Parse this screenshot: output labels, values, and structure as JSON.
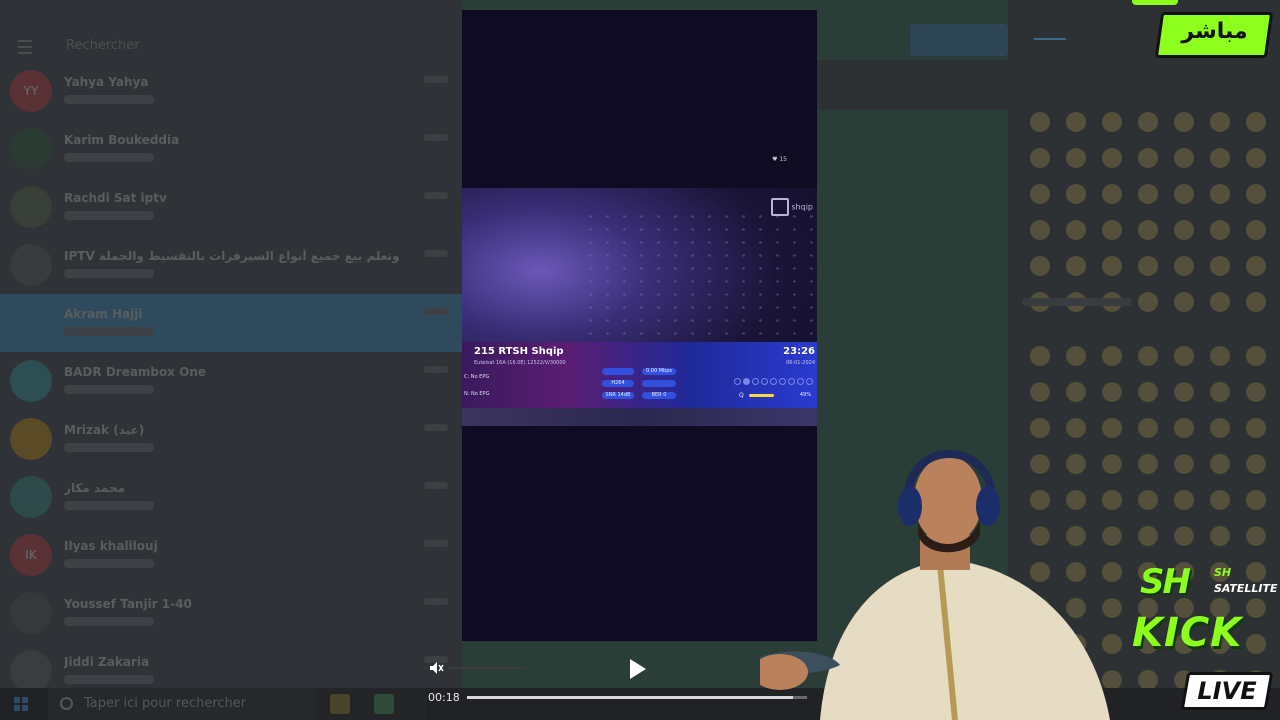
{
  "chat_list": {
    "search_placeholder": "Rechercher",
    "chats": [
      {
        "name": "Yahya Yahya",
        "avatar_text": "YY",
        "avatar_color": "#5a3236"
      },
      {
        "name": "Karim Boukeddia",
        "avatar_text": "",
        "avatar_color": "#2c3a34"
      },
      {
        "name": "Rachdi Sat iptv",
        "avatar_text": "",
        "avatar_color": "#39403a"
      },
      {
        "name": "IPTV تعلم وتعلم بيع جميع أنواع السيرفرات بالتقسيط والجملة",
        "avatar_text": "",
        "avatar_color": "#393b3e"
      },
      {
        "name": "Akram Hajji",
        "avatar_text": "",
        "avatar_color": "#2f4a5c"
      },
      {
        "name": "BADR Dreambox One",
        "avatar_text": "",
        "avatar_color": "#2d4e52"
      },
      {
        "name": "Mrizak (عبد)",
        "avatar_text": "",
        "avatar_color": "#5a4a26"
      },
      {
        "name": "محمد مكار",
        "avatar_text": "",
        "avatar_color": "#2f4a4a"
      },
      {
        "name": "Ilyas khalilouj",
        "avatar_text": "IK",
        "avatar_color": "#5a3236"
      },
      {
        "name": "Youssef Tanjir 1-40",
        "avatar_text": "",
        "avatar_color": "#36393c"
      },
      {
        "name": "Jiddi Zakaria",
        "avatar_text": "",
        "avatar_color": "#3a3d40"
      }
    ]
  },
  "taskbar": {
    "search_placeholder": "Taper ici pour rechercher"
  },
  "video": {
    "channel_name": "215 RTSH Shqip",
    "channel_sub": "Eutelsat 16A (16.0E) 12522/V/30000",
    "epg_now": "C: No EPG",
    "epg_next": "N: No EPG",
    "clock": "23:26",
    "date": "06-01-2024",
    "logo_text": "shqip",
    "hud_text": "♥ 15",
    "pill_bitrate": "0.00 Mbps",
    "pill_codec": "H264",
    "pill_snr": "SNR 14dB",
    "pill_ber": "BER 0",
    "q_label": "Q",
    "q_pct": "49%",
    "q_level": 0.49
  },
  "player": {
    "current_time": "00:18",
    "progress": 0.96,
    "state": "paused"
  },
  "overlay": {
    "live_ar": "مباشر",
    "brand_sh": "SH",
    "brand_sh_small": "SH",
    "brand_satellite": "SATELLITE",
    "brand_kick": "KICK",
    "brand_live": "LIVE",
    "accent": "#8dff1c"
  }
}
